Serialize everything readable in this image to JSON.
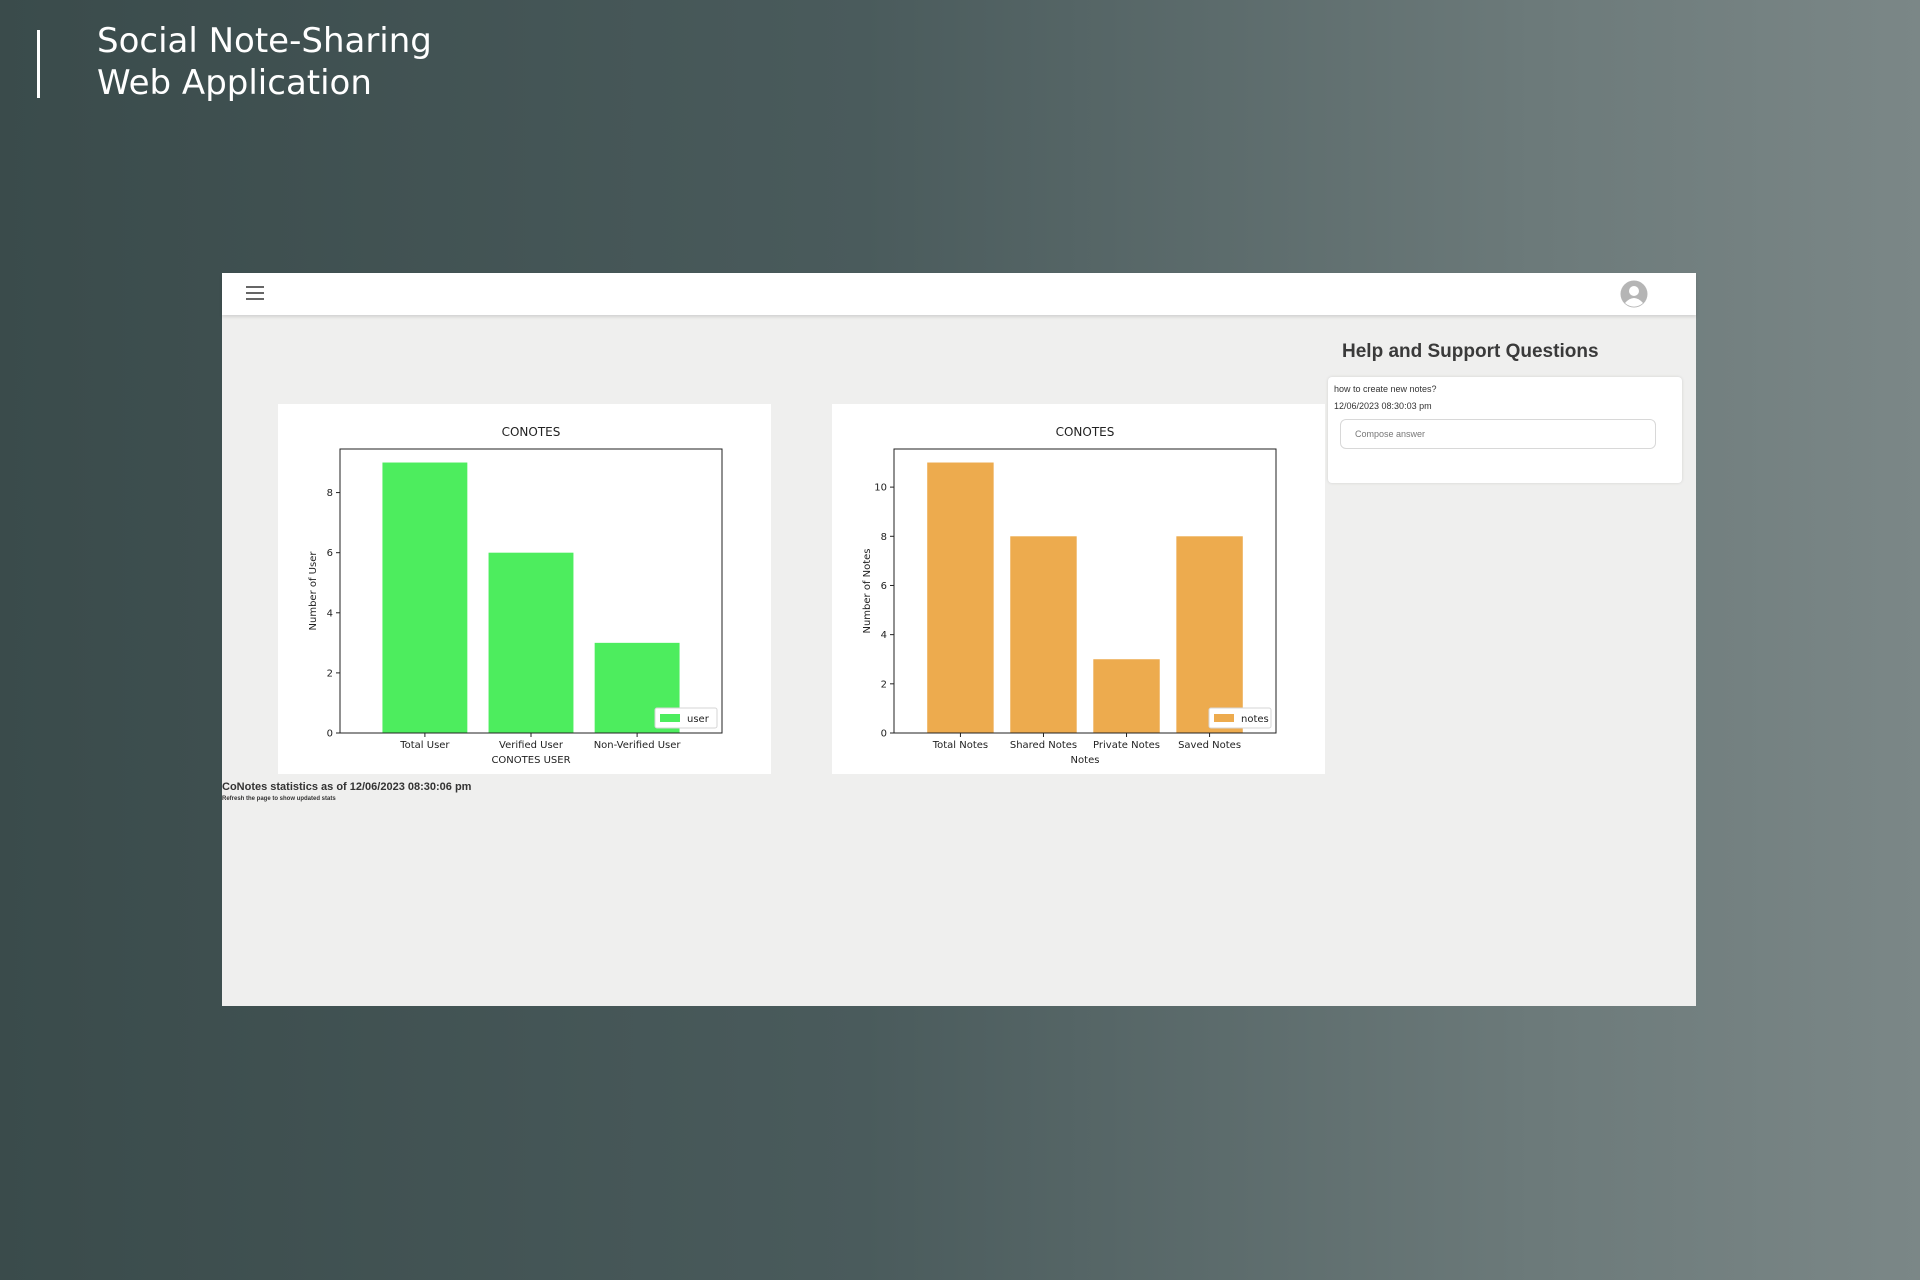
{
  "hero": {
    "line1": "Social Note-Sharing",
    "line2": "Web Application"
  },
  "topbar": {
    "menu_icon": "hamburger-menu-icon",
    "avatar_icon": "user-avatar-icon"
  },
  "stats": {
    "main": "CoNotes statistics as of 12/06/2023 08:30:06 pm",
    "sub": "Refresh the page to show updated stats"
  },
  "help": {
    "title": "Help and Support Questions",
    "questions": [
      {
        "text": "how to create new notes?",
        "date": "12/06/2023 08:30:03 pm",
        "answer_placeholder": "Compose answer"
      }
    ]
  },
  "chart_data": [
    {
      "type": "bar",
      "title": "CONOTES",
      "xlabel": "CONOTES USER",
      "ylabel": "Number of User",
      "categories": [
        "Total User",
        "Verified User",
        "Non-Verified User"
      ],
      "series": [
        {
          "name": "user",
          "values": [
            9,
            6,
            3
          ]
        }
      ],
      "yticks": [
        0,
        2,
        4,
        6,
        8
      ],
      "ylim": [
        0,
        9.45
      ],
      "color": "#4ded5e",
      "legend": "bottom-right",
      "grid": false
    },
    {
      "type": "bar",
      "title": "CONOTES",
      "xlabel": "Notes",
      "ylabel": "Number of Notes",
      "categories": [
        "Total Notes",
        "Shared Notes",
        "Private Notes",
        "Saved Notes"
      ],
      "series": [
        {
          "name": "notes",
          "values": [
            11,
            8,
            3,
            8
          ]
        }
      ],
      "yticks": [
        0,
        2,
        4,
        6,
        8,
        10
      ],
      "ylim": [
        0,
        11.55
      ],
      "color": "#edab4e",
      "legend": "bottom-right",
      "grid": false
    }
  ]
}
